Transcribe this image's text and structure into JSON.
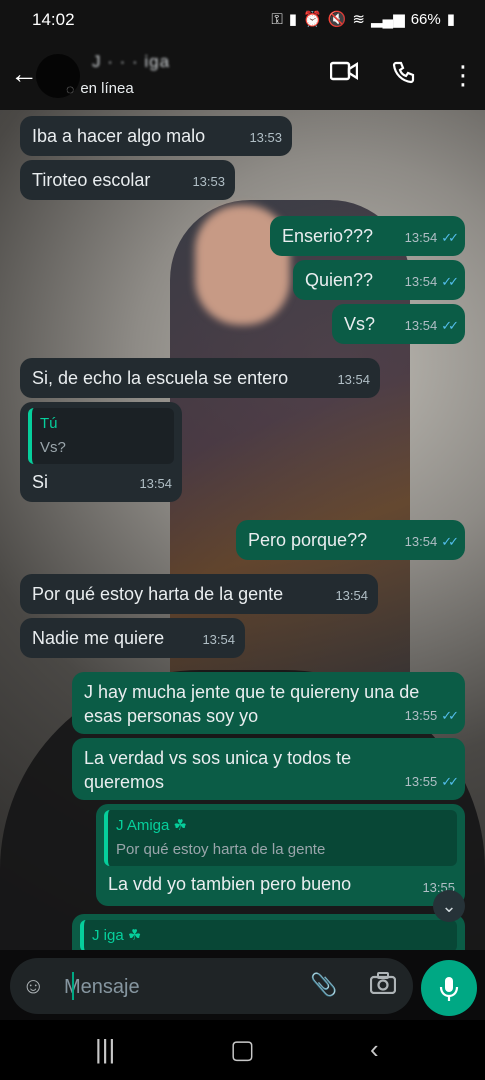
{
  "status_bar": {
    "time": "14:02",
    "battery": "66%"
  },
  "header": {
    "contact_name": "J  · · · iga",
    "status": "en línea"
  },
  "messages": [
    {
      "dir": "in",
      "text": "Iba a hacer algo malo",
      "time": "13:53"
    },
    {
      "dir": "in",
      "text": "Tiroteo escolar",
      "time": "13:53"
    },
    {
      "dir": "out",
      "text": "Enserio???",
      "time": "13:54"
    },
    {
      "dir": "out",
      "text": "Quien??",
      "time": "13:54"
    },
    {
      "dir": "out",
      "text": "Vs?",
      "time": "13:54"
    },
    {
      "dir": "in",
      "text": "Si, de echo la escuela se entero",
      "time": "13:54"
    },
    {
      "dir": "in",
      "quote_name": "Tú",
      "quote_text": "Vs?",
      "text": "Si",
      "time": "13:54"
    },
    {
      "dir": "out",
      "text": "Pero porque??",
      "time": "13:54"
    },
    {
      "dir": "in",
      "text": "Por qué estoy harta de la gente",
      "time": "13:54"
    },
    {
      "dir": "in",
      "text": "Nadie me quiere",
      "time": "13:54"
    },
    {
      "dir": "out",
      "text": "J   hay mucha jente que te quiereny una de esas personas soy yo",
      "time": "13:55"
    },
    {
      "dir": "out",
      "text": "La verdad vs sos unica y todos te queremos",
      "time": "13:55"
    },
    {
      "dir": "out",
      "quote_name": "J   Amiga ☘",
      "quote_text": "Por qué estoy harta de la gente",
      "text": "La vdd yo tambien pero bueno",
      "time": "13:55"
    },
    {
      "dir": "out",
      "quote_name": "J   iga ☘"
    }
  ],
  "input": {
    "placeholder": "Mensaje"
  },
  "colors": {
    "accent": "#00a884",
    "outgoing": "#0b5c46",
    "incoming": "#232b30",
    "read_ticks": "#53bdeb"
  }
}
